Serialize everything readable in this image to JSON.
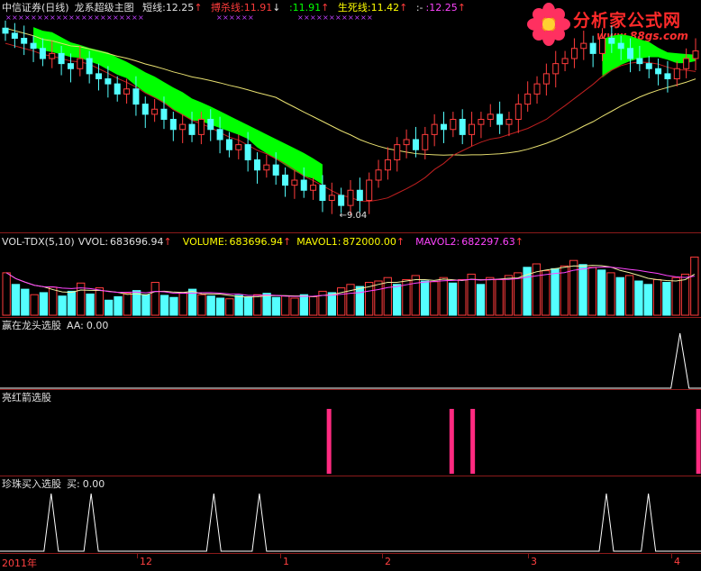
{
  "main_panel": {
    "title": "中信证券(日线)",
    "indicator": "龙系超级主图",
    "short_label": "短线:",
    "short_value": "12.25",
    "strangle_label": "搏杀线:",
    "strangle_value": "11.91",
    "third_value": ":11.91",
    "life_label": "生死线:",
    "life_value": "11.42",
    "extra_label": ":-",
    "extra_value": ":12.25",
    "low_annotation": "9.04"
  },
  "vol_panel": {
    "title": "VOL-TDX(5,10)",
    "vvol_label": "VVOL:",
    "vvol_value": "683696.94",
    "volume_label": "VOLUME:",
    "volume_value": "683696.94",
    "mavol1_label": "MAVOL1:",
    "mavol1_value": "872000.00",
    "mavol2_label": "MAVOL2:",
    "mavol2_value": "682297.63"
  },
  "panel3": {
    "title": "赢在龙头选股",
    "label": "AA:",
    "value": "0.00"
  },
  "panel4": {
    "title": "亮红箭选股"
  },
  "panel5": {
    "title": "珍珠买入选股",
    "label": "买:",
    "value": "0.00"
  },
  "x_axis": {
    "labels": [
      "2011年",
      "12",
      "1",
      "2",
      "3",
      "4"
    ]
  },
  "logo": {
    "name": "分析家公式网",
    "url": "www.88gs.com"
  },
  "colors": {
    "bg": "#000000",
    "up": "#ff3c3c",
    "down": "#54ffff",
    "sep": "#8b1a1a",
    "ma_green": "#00ff00",
    "ma_yellow": "#e8e070",
    "ma_red": "#c02020"
  },
  "chart_data": [
    {
      "type": "candlestick",
      "title": "中信证券(日线)",
      "low_marker": 9.04,
      "latest": {
        "short": 12.25,
        "strangle": 11.91,
        "life": 11.42
      },
      "closes": [
        12.6,
        12.5,
        12.4,
        12.3,
        12.1,
        12.2,
        12.0,
        11.9,
        12.1,
        11.8,
        11.7,
        11.6,
        11.4,
        11.5,
        11.2,
        11.0,
        11.1,
        10.9,
        10.7,
        10.8,
        10.6,
        10.9,
        10.7,
        10.5,
        10.3,
        10.4,
        10.1,
        9.9,
        10.0,
        9.8,
        9.6,
        9.7,
        9.5,
        9.6,
        9.3,
        9.4,
        9.2,
        9.5,
        9.3,
        9.7,
        9.9,
        10.1,
        10.4,
        10.5,
        10.3,
        10.6,
        10.8,
        10.7,
        10.9,
        10.6,
        10.8,
        10.9,
        11.0,
        10.8,
        10.9,
        11.2,
        11.4,
        11.6,
        11.8,
        12.0,
        12.1,
        12.3,
        12.4,
        12.2,
        12.5,
        12.4,
        12.3,
        12.1,
        12.0,
        11.9,
        11.8,
        11.7,
        11.9,
        12.1,
        12.25
      ]
    },
    {
      "type": "bar",
      "title": "VOL-TDX(5,10)",
      "values": [
        0.62,
        0.45,
        0.38,
        0.3,
        0.33,
        0.41,
        0.28,
        0.35,
        0.47,
        0.31,
        0.4,
        0.22,
        0.27,
        0.32,
        0.36,
        0.3,
        0.48,
        0.29,
        0.26,
        0.33,
        0.38,
        0.3,
        0.28,
        0.25,
        0.24,
        0.29,
        0.27,
        0.3,
        0.32,
        0.26,
        0.28,
        0.25,
        0.3,
        0.27,
        0.35,
        0.33,
        0.4,
        0.45,
        0.42,
        0.48,
        0.5,
        0.55,
        0.45,
        0.52,
        0.58,
        0.5,
        0.49,
        0.55,
        0.47,
        0.52,
        0.6,
        0.45,
        0.55,
        0.52,
        0.58,
        0.62,
        0.7,
        0.75,
        0.65,
        0.68,
        0.72,
        0.8,
        0.74,
        0.7,
        0.66,
        0.62,
        0.55,
        0.58,
        0.5,
        0.45,
        0.52,
        0.48,
        0.55,
        0.6,
        0.85
      ],
      "up_mask": [
        1,
        0,
        0,
        1,
        0,
        1,
        0,
        0,
        1,
        0,
        1,
        0,
        0,
        1,
        0,
        0,
        1,
        0,
        0,
        1,
        0,
        1,
        0,
        0,
        1,
        0,
        0,
        1,
        0,
        0,
        1,
        1,
        0,
        1,
        1,
        0,
        1,
        1,
        0,
        1,
        1,
        1,
        0,
        1,
        1,
        0,
        1,
        1,
        0,
        1,
        1,
        0,
        1,
        1,
        1,
        1,
        0,
        1,
        1,
        0,
        1,
        1,
        0,
        1,
        0,
        1,
        0,
        1,
        0,
        0,
        1,
        0,
        1,
        1,
        1
      ],
      "mavol1": 872000.0,
      "mavol2": 682297.63
    },
    {
      "type": "bar",
      "title": "赢在龙头选股",
      "spike_positions": [
        0.97
      ]
    },
    {
      "type": "bar",
      "title": "亮红箭选股",
      "spike_positions": [
        0.47,
        0.645,
        0.675,
        0.997
      ]
    },
    {
      "type": "line",
      "title": "珍珠买入选股",
      "spike_positions": [
        0.073,
        0.13,
        0.305,
        0.37,
        0.865,
        0.925
      ]
    }
  ]
}
